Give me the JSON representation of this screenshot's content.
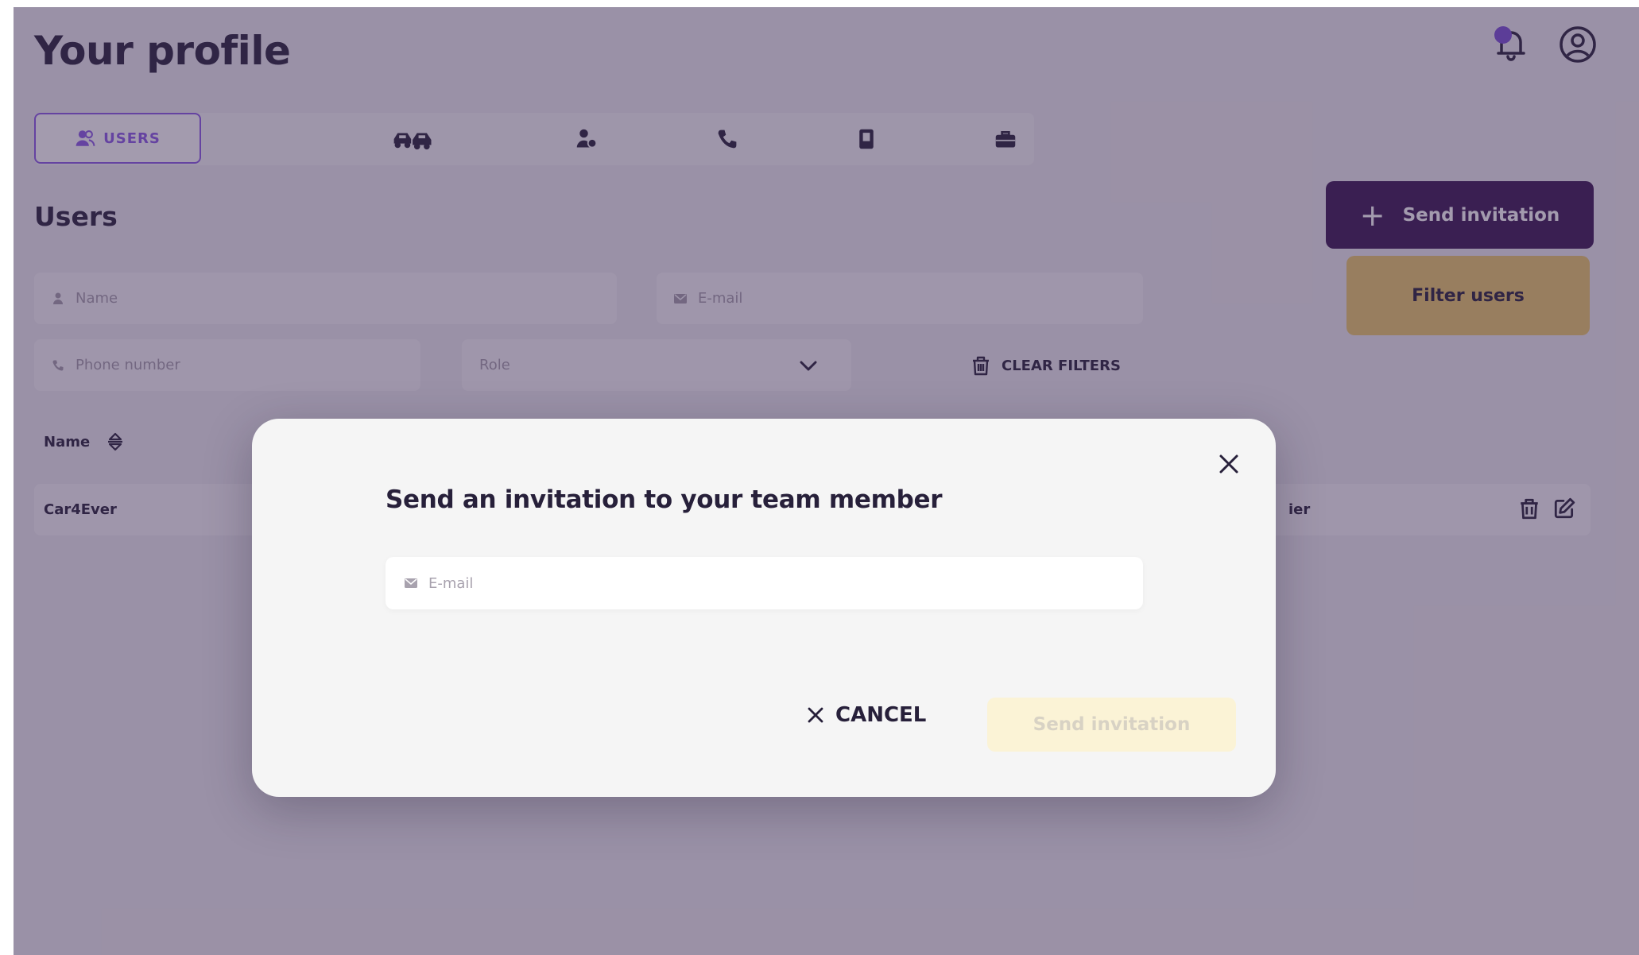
{
  "header": {
    "title": "Your profile"
  },
  "tabs": {
    "active_label": "USERS"
  },
  "section": {
    "title": "Users"
  },
  "actions": {
    "send_invitation": "Send invitation",
    "filter_users": "Filter users",
    "clear_filters": "CLEAR FILTERS"
  },
  "filters": {
    "name_placeholder": "Name",
    "email_placeholder": "E-mail",
    "phone_placeholder": "Phone number",
    "role_placeholder": "Role"
  },
  "table": {
    "column_name": "Name",
    "rows": [
      {
        "name": "Car4Ever",
        "role_fragment": "ier"
      }
    ]
  },
  "modal": {
    "title": "Send an invitation to your team member",
    "email_placeholder": "E-mail",
    "cancel_label": "CANCEL",
    "submit_label": "Send invitation"
  },
  "colors": {
    "accent_purple": "#8a5ae6",
    "primary_dark": "#3a1652",
    "filter_yellow": "#eac86a",
    "disabled_yellow": "#fbf3d6"
  }
}
